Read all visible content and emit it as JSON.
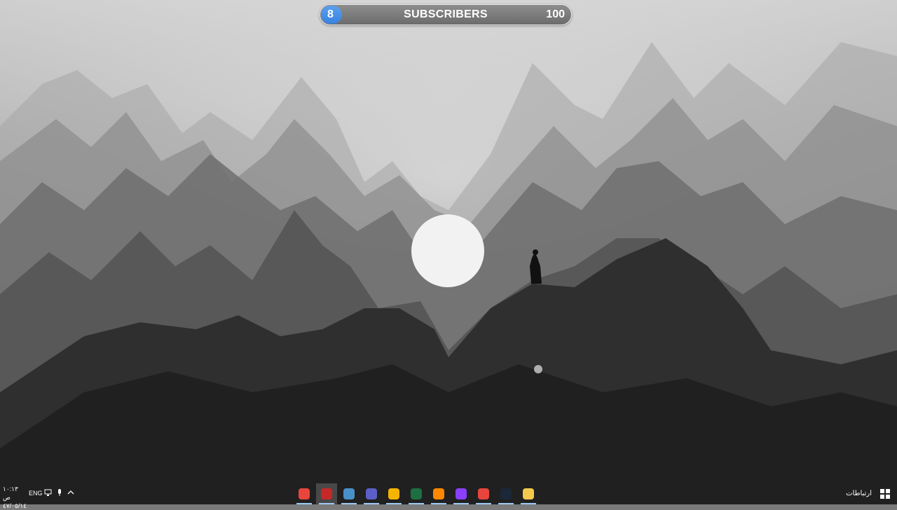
{
  "subscriber_widget": {
    "current": "8",
    "title": "SUBSCRIBERS",
    "goal": "100",
    "progress_fraction": 0.08,
    "accent_color": "#3a82e0"
  },
  "taskbar": {
    "clock_time": "١٠:١٣ ص",
    "clock_date": "٤٧/٠٥/١٤",
    "language": "ENG",
    "tray_icons": [
      "network-icon",
      "microphone-icon",
      "chevron-up-icon"
    ],
    "connections_label": "ارتباطات",
    "apps": [
      {
        "name": "chrome-canary-icon",
        "color": "#e8453c"
      },
      {
        "name": "circle-app-icon",
        "color": "#c62828"
      },
      {
        "name": "window-app-icon",
        "color": "#4a90c8"
      },
      {
        "name": "teams-icon",
        "color": "#5b5fc7"
      },
      {
        "name": "emoji-app-icon",
        "color": "#f4b400"
      },
      {
        "name": "excel-icon",
        "color": "#1d6f42"
      },
      {
        "name": "vlc-icon",
        "color": "#ff8800"
      },
      {
        "name": "messenger-icon",
        "color": "#8a3ffc"
      },
      {
        "name": "chrome-icon",
        "color": "#e8453c"
      },
      {
        "name": "steam-icon",
        "color": "#1b2838"
      },
      {
        "name": "file-explorer-icon",
        "color": "#f2c94c"
      }
    ]
  }
}
